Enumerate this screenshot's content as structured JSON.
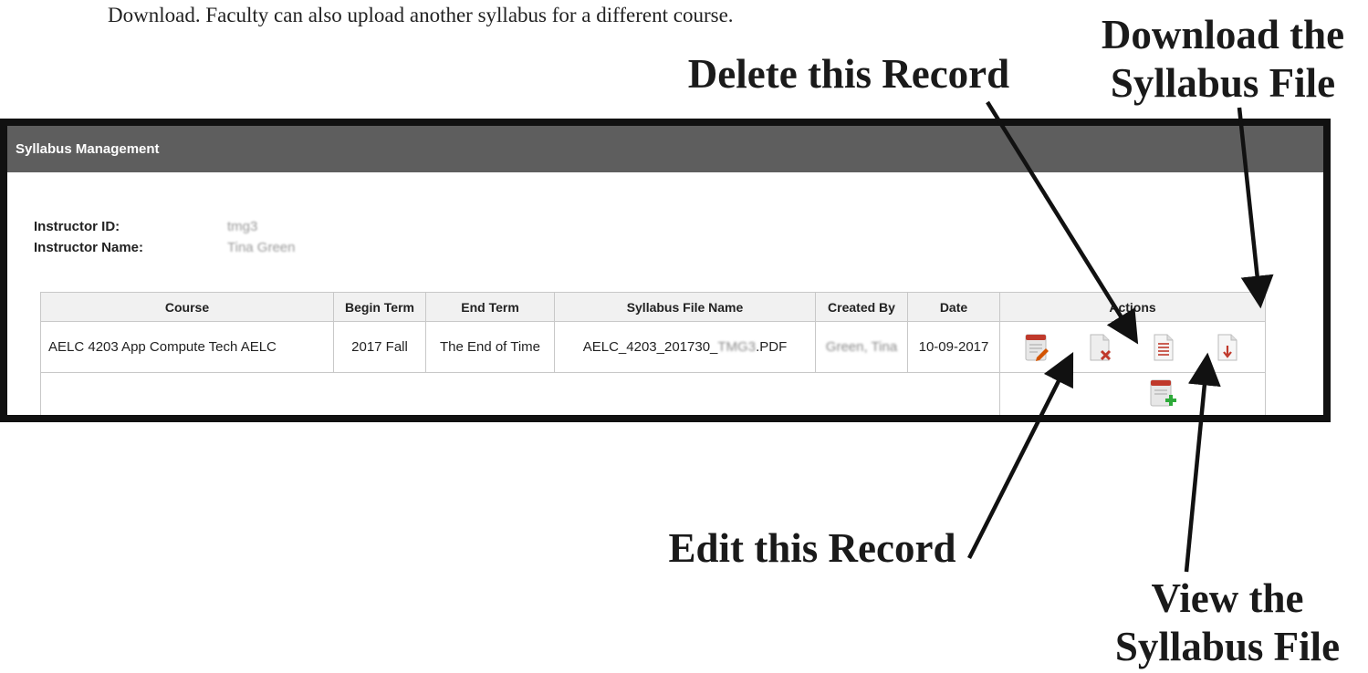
{
  "intro_text": "Download. Faculty can also upload another syllabus for a different course.",
  "callouts": {
    "delete": "Delete this Record",
    "download_line1": "Download the",
    "download_line2": "Syllabus File",
    "edit": "Edit this Record",
    "view_line1": "View the",
    "view_line2": "Syllabus File"
  },
  "panel": {
    "title": "Syllabus Management",
    "instructor_id_label": "Instructor ID:",
    "instructor_id_value": "tmg3",
    "instructor_name_label": "Instructor Name:",
    "instructor_name_value": "Tina Green"
  },
  "table": {
    "headers": [
      "Course",
      "Begin Term",
      "End Term",
      "Syllabus File Name",
      "Created By",
      "Date",
      "Actions"
    ],
    "rows": [
      {
        "course": "AELC 4203 App Compute Tech AELC",
        "begin_term": "2017 Fall",
        "end_term": "The End of Time",
        "file_name_prefix": "AELC_4203_201730_",
        "file_name_blurred": "TMG3",
        "file_name_suffix": ".PDF",
        "created_by": "Green, Tina",
        "date": "10-09-2017"
      }
    ]
  },
  "icons": {
    "edit": "edit-record-icon",
    "delete": "delete-record-icon",
    "view": "view-file-icon",
    "download": "download-file-icon",
    "add": "add-record-icon"
  },
  "colors": {
    "header_bg": "#5e5e5e",
    "icon_red": "#c0392b",
    "icon_green": "#2eaa3a",
    "border": "#111111"
  }
}
